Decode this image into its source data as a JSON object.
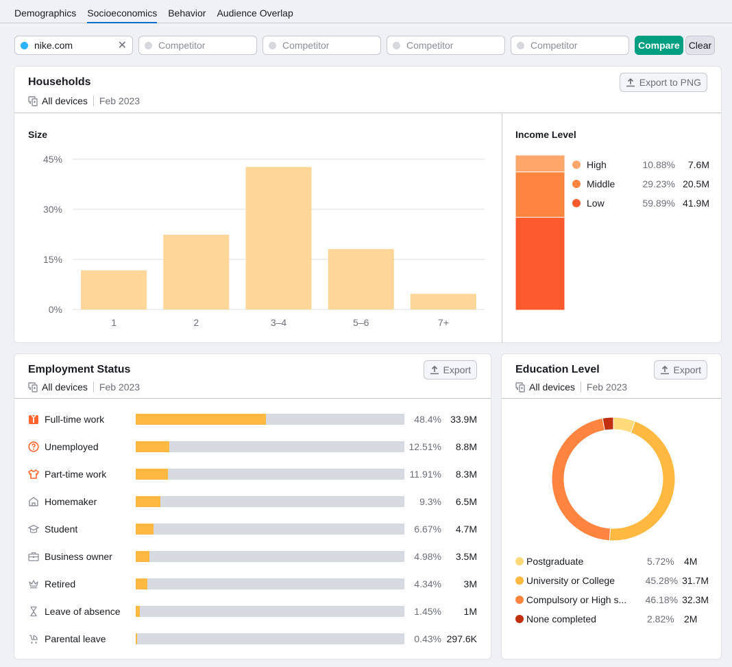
{
  "tabs": [
    {
      "label": "Demographics",
      "active": false
    },
    {
      "label": "Socioeconomics",
      "active": true
    },
    {
      "label": "Behavior",
      "active": false
    },
    {
      "label": "Audience Overlap",
      "active": false
    }
  ],
  "compare": {
    "domain": "nike.com",
    "competitor_placeholder": "Competitor",
    "compare_label": "Compare",
    "clear_label": "Clear"
  },
  "households": {
    "title": "Households",
    "devices": "All devices",
    "date": "Feb 2023",
    "export_label": "Export to PNG",
    "size_title": "Size",
    "income_title": "Income Level",
    "income": [
      {
        "label": "High",
        "pct": "10.88%",
        "value": "7.6M",
        "share": 10.88,
        "color": "#ffa66b"
      },
      {
        "label": "Middle",
        "pct": "29.23%",
        "value": "20.5M",
        "share": 29.23,
        "color": "#ff8440"
      },
      {
        "label": "Low",
        "pct": "59.89%",
        "value": "41.9M",
        "share": 59.89,
        "color": "#ff5a2e"
      }
    ]
  },
  "employment": {
    "title": "Employment Status",
    "devices": "All devices",
    "date": "Feb 2023",
    "export_label": "Export",
    "rows": [
      {
        "icon": "briefcase-fulltime-icon",
        "label": "Full-time work",
        "pct": "48.4%",
        "value": "33.9M",
        "share": 48.4,
        "highlight": true
      },
      {
        "icon": "question-circle-icon",
        "label": "Unemployed",
        "pct": "12.51%",
        "value": "8.8M",
        "share": 12.51,
        "highlight": true
      },
      {
        "icon": "tshirt-icon",
        "label": "Part-time work",
        "pct": "11.91%",
        "value": "8.3M",
        "share": 11.91,
        "highlight": true
      },
      {
        "icon": "home-icon",
        "label": "Homemaker",
        "pct": "9.3%",
        "value": "6.5M",
        "share": 9.3,
        "highlight": false
      },
      {
        "icon": "graduation-cap-icon",
        "label": "Student",
        "pct": "6.67%",
        "value": "4.7M",
        "share": 6.67,
        "highlight": false
      },
      {
        "icon": "briefcase-icon",
        "label": "Business owner",
        "pct": "4.98%",
        "value": "3.5M",
        "share": 4.98,
        "highlight": false
      },
      {
        "icon": "crown-icon",
        "label": "Retired",
        "pct": "4.34%",
        "value": "3M",
        "share": 4.34,
        "highlight": false
      },
      {
        "icon": "hourglass-icon",
        "label": "Leave of absence",
        "pct": "1.45%",
        "value": "1M",
        "share": 1.45,
        "highlight": false
      },
      {
        "icon": "stroller-icon",
        "label": "Parental leave",
        "pct": "0.43%",
        "value": "297.6K",
        "share": 0.43,
        "highlight": false
      }
    ]
  },
  "education": {
    "title": "Education Level",
    "devices": "All devices",
    "date": "Feb 2023",
    "export_label": "Export",
    "rows": [
      {
        "label": "Postgraduate",
        "pct": "5.72%",
        "value": "4M",
        "share": 5.72,
        "color": "#ffd97a"
      },
      {
        "label": "University or College",
        "pct": "45.28%",
        "value": "31.7M",
        "share": 45.28,
        "color": "#ffb840"
      },
      {
        "label": "Compulsory or High s...",
        "pct": "46.18%",
        "value": "32.3M",
        "share": 46.18,
        "color": "#ff8440"
      },
      {
        "label": "None completed",
        "pct": "2.82%",
        "value": "2M",
        "share": 2.82,
        "color": "#c0300f"
      }
    ]
  },
  "chart_data": [
    {
      "type": "bar",
      "title": "Size",
      "categories": [
        "1",
        "2",
        "3–4",
        "5–6",
        "7+"
      ],
      "values": [
        11.7,
        22.4,
        42.7,
        18.1,
        4.7
      ],
      "yticks": [
        "0%",
        "15%",
        "30%",
        "45%"
      ],
      "ylim": [
        0,
        45
      ],
      "xlabel": "",
      "ylabel": "",
      "grid": true,
      "color": "#ffd699"
    },
    {
      "type": "bar",
      "title": "Income Level",
      "categories": [
        "High",
        "Middle",
        "Low"
      ],
      "values": [
        10.88,
        29.23,
        59.89
      ],
      "stacked": true
    },
    {
      "type": "pie",
      "title": "Education Level",
      "categories": [
        "Postgraduate",
        "University or College",
        "Compulsory or High school",
        "None completed"
      ],
      "values": [
        5.72,
        45.28,
        46.18,
        2.82
      ],
      "donut": true
    }
  ]
}
